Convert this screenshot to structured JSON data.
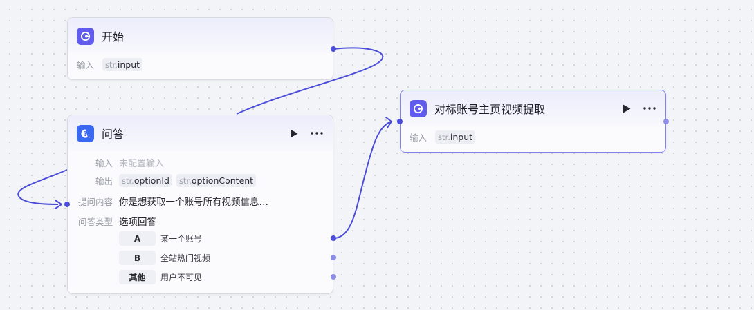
{
  "start_node": {
    "title": "开始",
    "input_label": "输入",
    "input_type": "str.",
    "input_name": "input"
  },
  "qa_node": {
    "title": "问答",
    "input_label": "输入",
    "input_value": "未配置输入",
    "output_label": "输出",
    "outputs": [
      {
        "type": "str.",
        "name": "optionId"
      },
      {
        "type": "str.",
        "name": "optionContent"
      }
    ],
    "prompt_label": "提问内容",
    "prompt_value": "你是想获取一个账号所有视频信息…",
    "answer_type_label": "问答类型",
    "answer_type_value": "选项回答",
    "options": [
      {
        "key": "A",
        "text": "某一个账号"
      },
      {
        "key": "B",
        "text": "全站热门视频"
      },
      {
        "key": "其他",
        "text": "用户不可见"
      }
    ]
  },
  "extract_node": {
    "title": "对标账号主页视频提取",
    "input_label": "输入",
    "input_type": "str.",
    "input_name": "input"
  },
  "colors": {
    "wire": "#4b4dd8",
    "start_icon": "#615ced",
    "qa_icon": "#3b68f3",
    "selected_border": "#7f84ea"
  },
  "icons": {
    "start": "start-node-icon",
    "qa": "question-node-icon",
    "extract": "plugin-node-icon",
    "run": "play-icon",
    "more": "more-dots-icon"
  }
}
